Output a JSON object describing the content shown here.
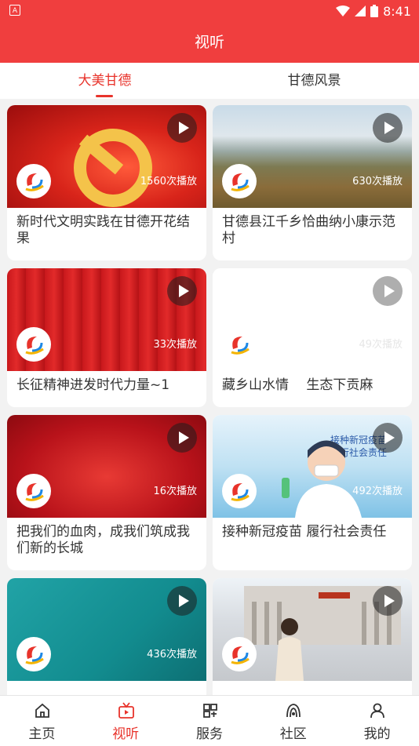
{
  "status": {
    "left_icon": "A",
    "time": "8:41"
  },
  "header": {
    "title": "视听"
  },
  "tabs": [
    {
      "label": "大美甘德",
      "active": true
    },
    {
      "label": "甘德风景",
      "active": false
    }
  ],
  "cards": [
    {
      "title": "新时代文明实践在甘德开花结果",
      "plays": "1560次播放"
    },
    {
      "title": "甘德县江千乡恰曲纳小康示范村",
      "plays": "630次播放"
    },
    {
      "title": "长征精神进发时代力量~1",
      "plays": "33次播放"
    },
    {
      "title": "藏乡山水情　 生态下贡麻",
      "plays": "49次播放"
    },
    {
      "title": "把我们的血肉，成我们筑成我们新的长城",
      "plays": "16次播放"
    },
    {
      "title": " 接种新冠疫苗  履行社会责任",
      "plays": "492次播放",
      "banner_text": "接种新冠疫苗 履行社会责任"
    },
    {
      "title": "",
      "plays": "436次播放"
    },
    {
      "title": "",
      "plays": ""
    }
  ],
  "nav": [
    {
      "label": "主页",
      "icon": "home-icon",
      "active": false
    },
    {
      "label": "视听",
      "icon": "tv-icon",
      "active": true
    },
    {
      "label": "服务",
      "icon": "grid-icon",
      "active": false
    },
    {
      "label": "社区",
      "icon": "community-icon",
      "active": false
    },
    {
      "label": "我的",
      "icon": "user-icon",
      "active": false
    }
  ],
  "colors": {
    "brand": "#f03e3e",
    "accent": "#e8332b"
  }
}
